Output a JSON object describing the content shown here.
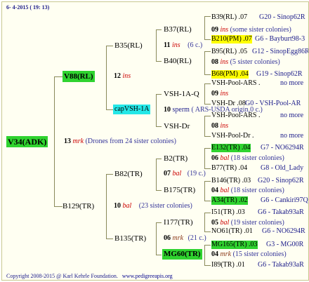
{
  "header": "6-  4-2015 ( 19: 13)",
  "footer": {
    "copyright": "Copyright 2008-2015 @ Karl Kehrle Foundation.",
    "url": "www.pedigreeapis.org"
  },
  "root": {
    "id": "V34(ADK)",
    "gen": "13",
    "sym": "mrk",
    "note": "(Drones from 24 sister colonies)"
  },
  "sire": {
    "id": "V88(RL)",
    "gen": "12",
    "sym": "ins"
  },
  "dam": {
    "id": "B129(TR)",
    "gen": "10",
    "sym": "bal",
    "note": "(23 sister colonies)"
  },
  "ss": {
    "id": "B35(RL)",
    "gen": "11",
    "sym": "ins",
    "note": "(6 c.)"
  },
  "sd": {
    "id": "capVSH-1A",
    "gen": "10",
    "sym": "sperm",
    "note": "( ARS-USDA origin,0 c.)"
  },
  "ds": {
    "id": "B82(TR)",
    "gen": "07",
    "sym": "bal",
    "note": "(19 c.)"
  },
  "dd": {
    "id": "B135(TR)",
    "gen": "06",
    "sym": "mrk",
    "note": "(21 c.)"
  },
  "g3": {
    "b37": "B37(RL)",
    "b37_gen": "09",
    "b37_sym": "ins",
    "b37_note": "(some sister colonies)",
    "b40": "B40(RL)",
    "b40_gen": "08",
    "b40_sym": "ins",
    "b40_note": "(5 sister colonies)",
    "vq": "VSH-1A-Q",
    "vq_gen": "09",
    "vq_sym": "ins",
    "vd": "VSH-Dr",
    "vd_gen": "08",
    "vd_sym": "ins",
    "b2": "B2(TR)",
    "b2_gen": "06",
    "b2_sym": "bal",
    "b2_note": "(18 sister colonies)",
    "b175": "B175(TR)",
    "b175_gen": "04",
    "b175_sym": "bal",
    "b175_note": "(18 sister colonies)",
    "i177": "I177(TR)",
    "i177_gen": "05",
    "i177_sym": "bal",
    "i177_note": "(19 sister colonies)",
    "mg60": "MG60(TR)",
    "mg60_gen": "04",
    "mg60_sym": "mrk",
    "mg60_note": "(15 sister colonies)"
  },
  "g4": {
    "a1": "B39(RL) .07",
    "a1r": "G20 - Sinop62R",
    "a2": "B210(PM) .07",
    "a2r": "G6 - Bayburt98-3",
    "a3": "B95(RL) .05",
    "a3r": "G12 - SinopEgg86R",
    "a4": "B68(PM) .04",
    "a4r": "G19 - Sinop62R",
    "a5": "VSH-Pool-ARS .",
    "a5r": "no more",
    "a6": "VSH-Dr .08",
    "a6r": "G0 - VSH-Pool-AR",
    "a7": "VSH-Pool-ARS .",
    "a7r": "no more",
    "a8": "VSH-Pool-Dr .",
    "a8r": "no more",
    "a9": "E132(TR) .04",
    "a9r": "G7 - NO6294R",
    "a10": "B77(TR) .04",
    "a10r": "G8 - Old_Lady",
    "a11": "B146(TR) .03",
    "a11r": "G20 - Sinop62R",
    "a12": "A34(TR) .02",
    "a12r": "G6 - Cankiri97Q",
    "a13": "I51(TR) .03",
    "a13r": "G6 - Takab93aR",
    "a14": "NO61(TR) .01",
    "a14r": "G6 - NO6294R",
    "a15": "MG165(TR) .03",
    "a15r": "G3 - MG00R",
    "a16": "I89(TR) .01",
    "a16r": "G6 - Takab93aR"
  }
}
